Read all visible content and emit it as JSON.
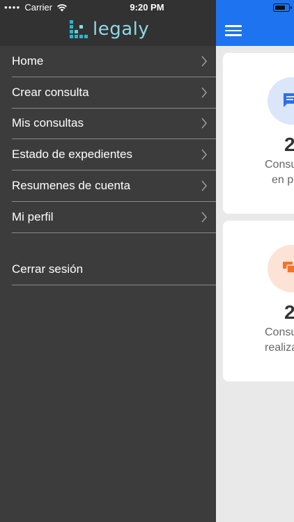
{
  "status_bar": {
    "carrier": "Carrier",
    "time": "9:20 PM"
  },
  "logo": {
    "text": "legaly"
  },
  "menu": {
    "items": [
      {
        "label": "Home"
      },
      {
        "label": "Crear consulta"
      },
      {
        "label": "Mis consultas"
      },
      {
        "label": "Estado de expedientes"
      },
      {
        "label": "Resumenes de cuenta"
      },
      {
        "label": "Mi perfil"
      }
    ],
    "logout_label": "Cerrar sesión"
  },
  "cards": [
    {
      "value": "2",
      "line1": "Consu",
      "line2": "en p"
    },
    {
      "value": "2",
      "line1": "Consu",
      "line2": "realiza"
    }
  ],
  "colors": {
    "drawer_bg": "#3c3c3c",
    "header_bg": "#323232",
    "accent": "#1e74f0",
    "logo": "#8dd9e6",
    "card1_icon": "#2f6fe8",
    "card2_icon": "#f27427"
  }
}
